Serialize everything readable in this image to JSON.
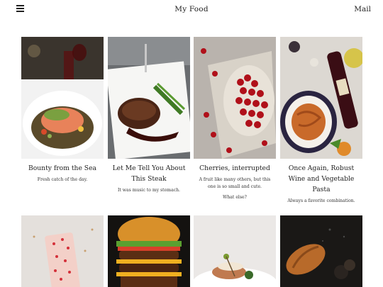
{
  "header": {
    "site_title": "My Food",
    "mail_label": "Mail",
    "menu_icon": "hamburger-icon"
  },
  "posts": [
    {
      "title": "Bounty from the Sea",
      "excerpt": "Fresh catch of the day."
    },
    {
      "title": "Let Me Tell You About This Steak",
      "excerpt": "It was music to my stomach."
    },
    {
      "title": "Cherries, interrupted",
      "excerpt": "A fruit like many others, but this one is so small and cute.",
      "extra": "What else?"
    },
    {
      "title": "Once Again, Robust Wine and Vegetable Pasta",
      "excerpt": "Always a favorite combination."
    }
  ]
}
